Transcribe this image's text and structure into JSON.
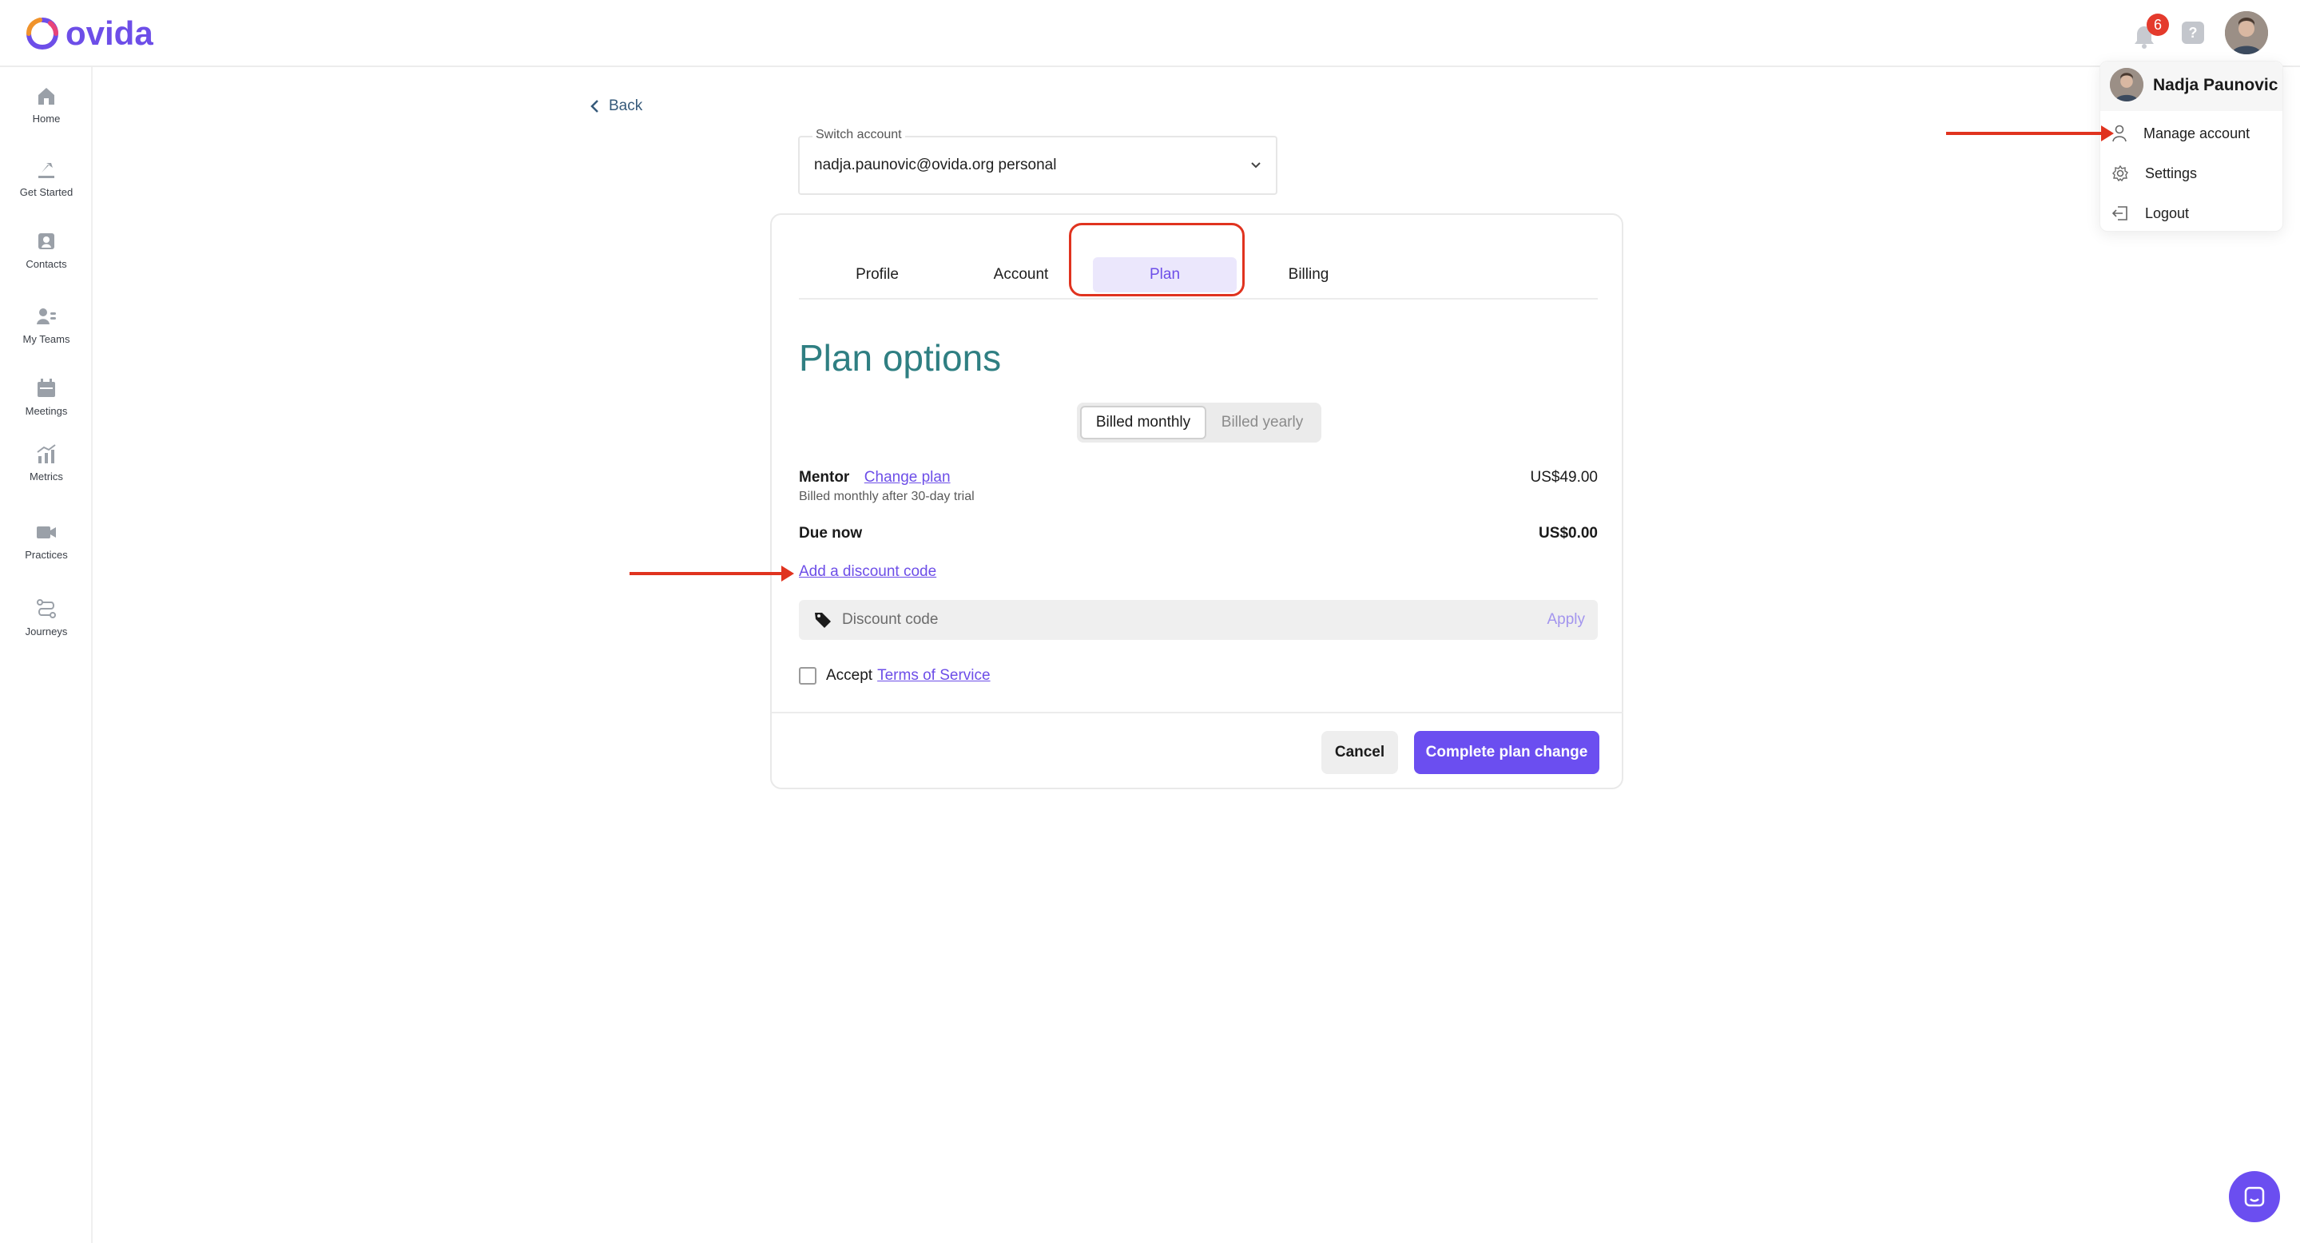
{
  "brand": {
    "name": "ovida",
    "color": "#6d4ee8"
  },
  "header": {
    "notifications_count": "6",
    "help_label": "?"
  },
  "sidebar": {
    "items": [
      {
        "label": "Home",
        "icon": "home-icon"
      },
      {
        "label": "Get Started",
        "icon": "flag-icon"
      },
      {
        "label": "Contacts",
        "icon": "contact-icon"
      },
      {
        "label": "My Teams",
        "icon": "team-icon"
      },
      {
        "label": "Meetings",
        "icon": "calendar-icon"
      },
      {
        "label": "Metrics",
        "icon": "chart-icon"
      },
      {
        "label": "Practices",
        "icon": "video-icon"
      },
      {
        "label": "Journeys",
        "icon": "route-icon"
      }
    ]
  },
  "back_label": "Back",
  "switch_account": {
    "label": "Switch account",
    "value": "nadja.paunovic@ovida.org personal"
  },
  "tabs": [
    {
      "label": "Profile",
      "active": false
    },
    {
      "label": "Account",
      "active": false
    },
    {
      "label": "Plan",
      "active": true
    },
    {
      "label": "Billing",
      "active": false
    }
  ],
  "plan": {
    "title": "Plan options",
    "billing_toggle": {
      "monthly": "Billed monthly",
      "yearly": "Billed yearly",
      "selected": "monthly"
    },
    "mentor": {
      "name": "Mentor",
      "change_label": "Change plan",
      "subtitle": "Billed monthly after 30-day trial",
      "price": "US$49.00"
    },
    "due": {
      "label": "Due now",
      "price": "US$0.00"
    },
    "discount_link": "Add a discount code",
    "discount_placeholder": "Discount code",
    "apply_label": "Apply",
    "accept_label": "Accept",
    "tos_label": "Terms of Service",
    "cancel_label": "Cancel",
    "complete_label": "Complete plan change"
  },
  "user_menu": {
    "name": "Nadja Paunovic",
    "items": [
      {
        "label": "Manage account",
        "icon": "user-icon"
      },
      {
        "label": "Settings",
        "icon": "gear-icon"
      },
      {
        "label": "Logout",
        "icon": "logout-icon"
      }
    ]
  },
  "colors": {
    "accent": "#6b4ef0",
    "title_teal": "#2f7f82",
    "annotation_red": "#e0331f"
  }
}
